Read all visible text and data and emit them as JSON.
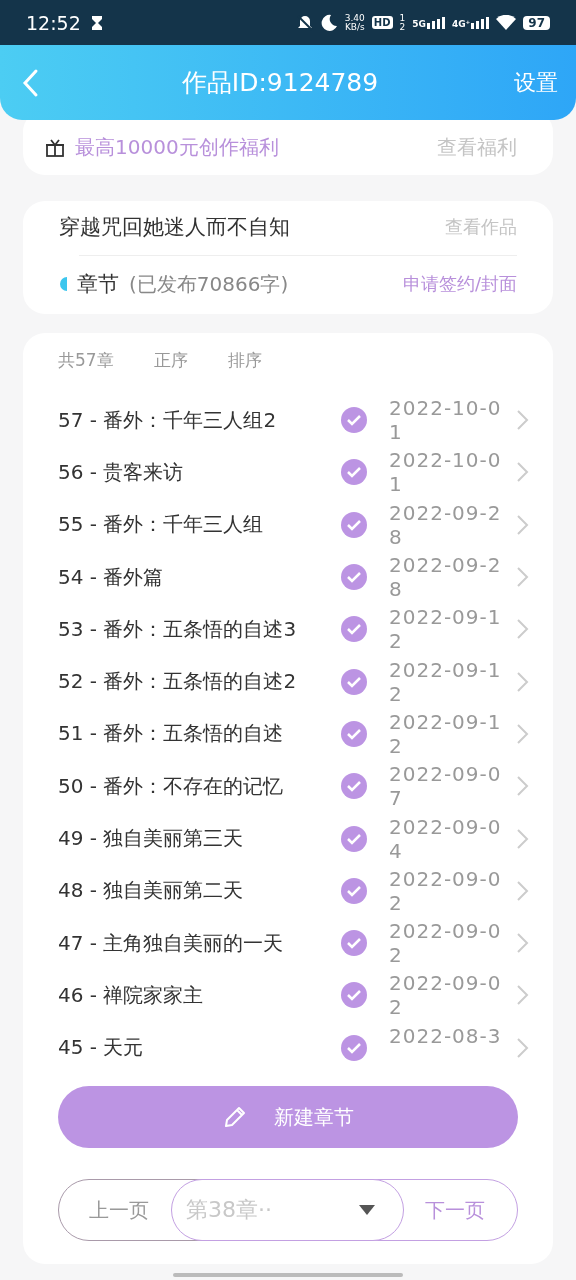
{
  "status_bar": {
    "time": "12:52",
    "speed_value": "3.40",
    "speed_unit": "KB/s",
    "hd_label": "HD",
    "sim_1": "1",
    "sim_2": "2",
    "net_5g": "5G",
    "net_4g": "4G⁺",
    "battery": "97"
  },
  "header": {
    "title": "作品ID:9124789",
    "action": "设置"
  },
  "promo": {
    "text": "最高10000元创作福利",
    "link": "查看福利"
  },
  "work": {
    "title": "穿越咒回她迷人而不自知",
    "link": "查看作品",
    "section": "章节",
    "published": "(已发布70866字)",
    "apply": "申请签约/封面"
  },
  "list_header": {
    "count": "共57章",
    "order": "正序",
    "sort": "排序"
  },
  "chapters": [
    {
      "title": "57 - 番外：千年三人组2",
      "date": "2022-10-01",
      "published": true
    },
    {
      "title": "56 - 贵客来访",
      "date": "2022-10-01",
      "published": true
    },
    {
      "title": "55 - 番外：千年三人组",
      "date": "2022-09-28",
      "published": true
    },
    {
      "title": "54 - 番外篇",
      "date": "2022-09-28",
      "published": true
    },
    {
      "title": "53 - 番外：五条悟的自述3",
      "date": "2022-09-12",
      "published": true
    },
    {
      "title": "52 - 番外：五条悟的自述2",
      "date": "2022-09-12",
      "published": true
    },
    {
      "title": "51 - 番外：五条悟的自述",
      "date": "2022-09-12",
      "published": true
    },
    {
      "title": "50 - 番外：不存在的记忆",
      "date": "2022-09-07",
      "published": true
    },
    {
      "title": "49 - 独自美丽第三天",
      "date": "2022-09-04",
      "published": true
    },
    {
      "title": "48 - 独自美丽第二天",
      "date": "2022-09-02",
      "published": true
    },
    {
      "title": "47 - 主角独自美丽的一天",
      "date": "2022-09-02",
      "published": true
    },
    {
      "title": "46 - 禅院家家主",
      "date": "2022-09-02",
      "published": true
    },
    {
      "title": "45 - 天元",
      "date": "2022-08-3",
      "published": true
    }
  ],
  "new_button": "新建章节",
  "pager": {
    "prev": "上一页",
    "chapter": "第38章··",
    "next": "下一页"
  }
}
